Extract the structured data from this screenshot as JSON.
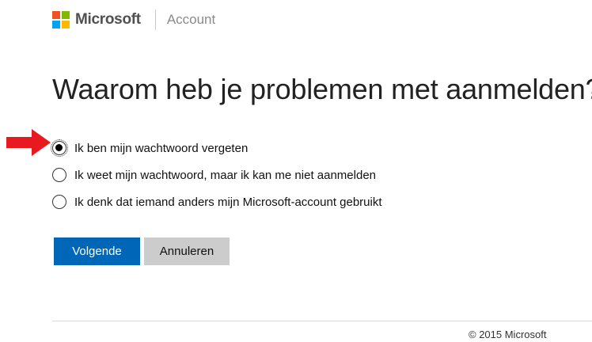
{
  "header": {
    "brand": "Microsoft",
    "section": "Account"
  },
  "main": {
    "title": "Waarom heb je problemen met aanmelden?",
    "options": [
      {
        "label": "Ik ben mijn wachtwoord vergeten",
        "checked": true
      },
      {
        "label": "Ik weet mijn wachtwoord, maar ik kan me niet aanmelden",
        "checked": false
      },
      {
        "label": "Ik denk dat iemand anders mijn Microsoft-account gebruikt",
        "checked": false
      }
    ],
    "next_label": "Volgende",
    "cancel_label": "Annuleren"
  },
  "footer": {
    "copyright": "© 2015 Microsoft"
  },
  "colors": {
    "primary_button": "#0067b8",
    "secondary_button": "#cccccc",
    "annotation_arrow": "#e8191f",
    "logo": [
      "#f25022",
      "#7fba00",
      "#00a4ef",
      "#ffb900"
    ]
  }
}
